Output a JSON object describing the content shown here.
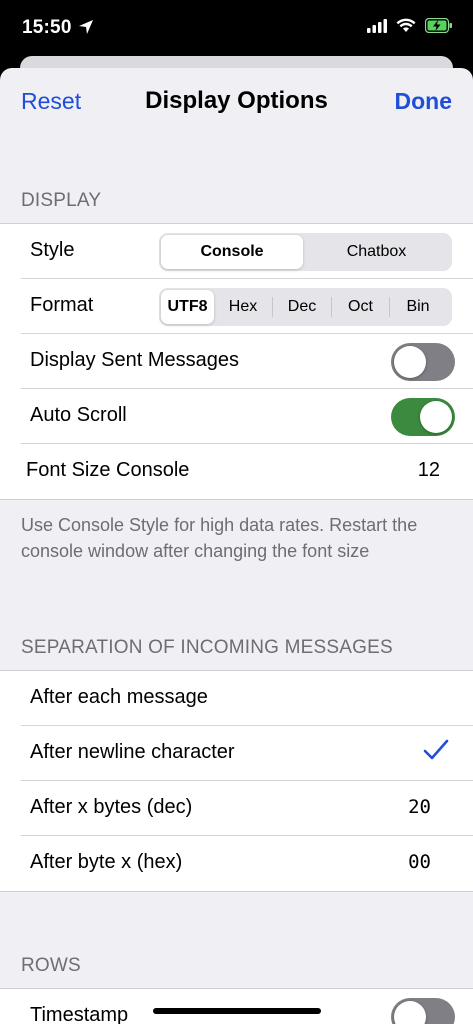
{
  "status": {
    "time": "15:50"
  },
  "nav": {
    "reset_label": "Reset",
    "title": "Display Options",
    "done_label": "Done"
  },
  "display": {
    "header": "DISPLAY",
    "style_label": "Style",
    "style_options": [
      "Console",
      "Chatbox"
    ],
    "style_selected": "Console",
    "format_label": "Format",
    "format_options": [
      "UTF8",
      "Hex",
      "Dec",
      "Oct",
      "Bin"
    ],
    "format_selected": "UTF8",
    "sent_label": "Display Sent Messages",
    "sent_on": false,
    "autoscroll_label": "Auto Scroll",
    "autoscroll_on": true,
    "fontsize_label": "Font Size Console",
    "fontsize_value": "12",
    "note": "Use Console Style for high data rates. Restart the console window after changing the font size"
  },
  "separation": {
    "header": "SEPARATION OF INCOMING MESSAGES",
    "each_label": "After each message",
    "newline_label": "After newline character",
    "selected": "After newline character",
    "bytes_label": "After x bytes (dec)",
    "bytes_value": "20",
    "byte_hex_label": "After byte x (hex)",
    "byte_hex_value": "00"
  },
  "rows": {
    "header": "ROWS",
    "timestamp_label": "Timestamp",
    "timestamp_on": false
  },
  "colors": {
    "accent": "#1f4fd8",
    "toggle_on": "#3c8a3f",
    "toggle_off": "#7f7f85"
  }
}
